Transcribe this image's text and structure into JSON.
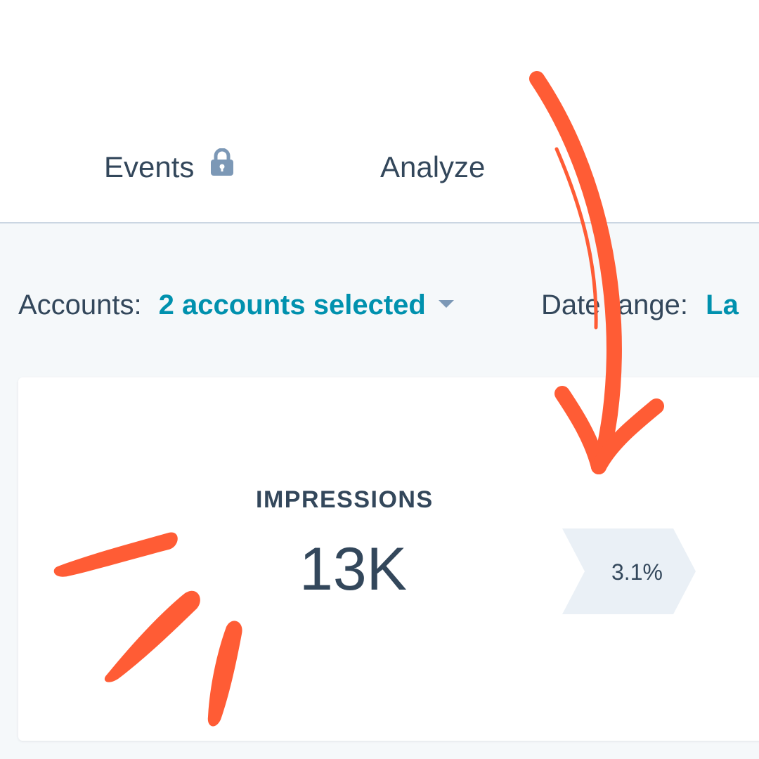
{
  "nav": {
    "tabs": [
      {
        "label": "Events",
        "icon": "lock-icon"
      },
      {
        "label": "Analyze"
      }
    ]
  },
  "filters": {
    "accounts_label": "Accounts:",
    "accounts_value": "2 accounts selected",
    "date_label": "Date range:",
    "date_value": "La"
  },
  "metric": {
    "label": "IMPRESSIONS",
    "value": "13K",
    "change": "3.1%"
  },
  "colors": {
    "accent": "#0091ae",
    "text": "#33475b",
    "annotation": "#ff5c35",
    "badge": "#eaf0f6"
  }
}
